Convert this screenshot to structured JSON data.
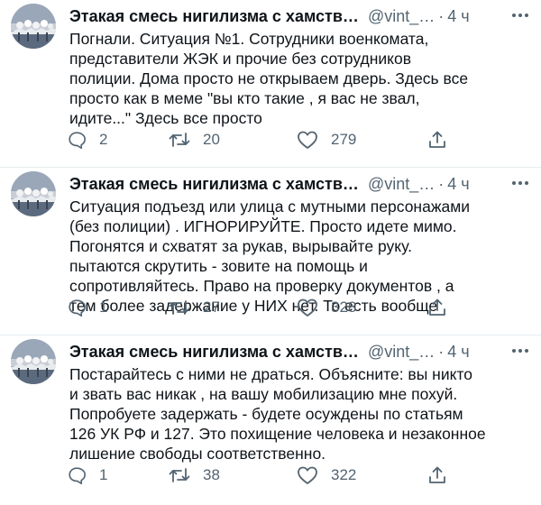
{
  "tweets": [
    {
      "author_name": "Этакая смесь нигилизма с хамств…",
      "handle": "@vint_…",
      "separator": "·",
      "time": "4 ч",
      "text": "Погнали. Ситуация №1. Сотрудники военкомата,\nпредставители ЖЭК и прочие без сотрудников\nполиции. Дома просто не открываем дверь. Здесь все\nпросто как в меме \"вы кто такие , я вас не звал,\nидите...\" Здесь все просто",
      "replies": "2",
      "retweets": "20",
      "likes": "279"
    },
    {
      "author_name": "Этакая смесь нигилизма с хамств…",
      "handle": "@vint_…",
      "separator": "·",
      "time": "4 ч",
      "text": "Ситуация подъезд или улица с мутными персонажами\n(без полиции) . ИГНОРИРУЙТЕ. Просто идете мимо.\nПогонятся и схватят за рукав, вырывайте руку.\nпытаются скрутить - зовите на помощь и\nсопротивляйтесь. Право на проверку документов , а\nтем более задержание у НИХ нет. То есть вообще",
      "replies": "1",
      "retweets": "27",
      "likes": "328"
    },
    {
      "author_name": "Этакая смесь нигилизма с хамств…",
      "handle": "@vint_…",
      "separator": "·",
      "time": "4 ч",
      "text": "Постарайтесь с ними не драться. Объясните: вы никто\nи звать вас никак , на вашу мобилизацию мне похуй.\nПопробуете задержать - будете осуждены по статьям\n126 УК РФ и 127. Это похищение человека и незаконное\nлишение свободы соответственно.",
      "replies": "1",
      "retweets": "38",
      "likes": "322"
    }
  ],
  "icons": {
    "avatar": "avatar-image",
    "more": "more-options-icon",
    "reply": "reply-icon",
    "retweet": "retweet-icon",
    "like": "heart-icon",
    "share": "share-icon"
  },
  "colors": {
    "text": "#0f1419",
    "secondary": "#536471",
    "divider": "#e6ecf0"
  }
}
